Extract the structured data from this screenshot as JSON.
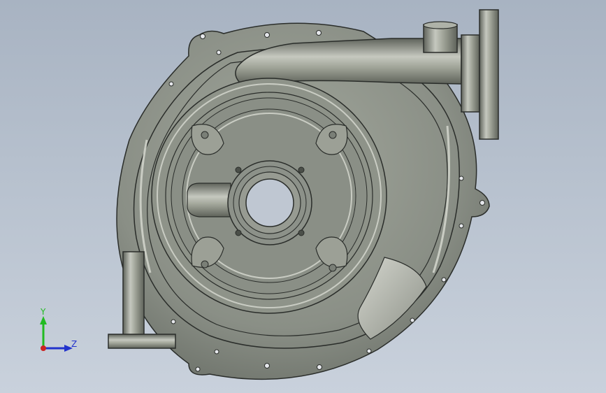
{
  "viewport": {
    "background_top": "#a8b3c2",
    "background_bottom": "#c9d1dc"
  },
  "model": {
    "part": "pump-volute-casing",
    "body_color": "#8c9189",
    "edge_color": "#2a2d2a",
    "highlight_color": "#c9ccc3"
  },
  "triad": {
    "x_label": "",
    "y_label": "Y",
    "z_label": "Z",
    "y_color": "#22bb22",
    "z_color": "#2233cc",
    "x_color": "#cc2222"
  }
}
